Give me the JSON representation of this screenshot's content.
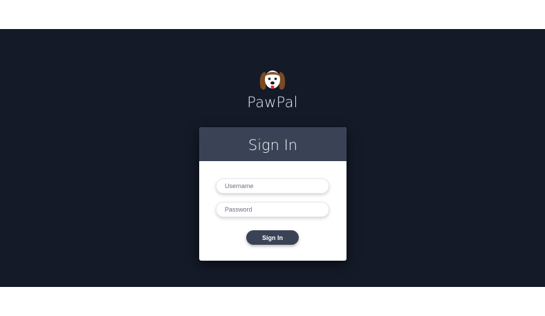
{
  "app": {
    "brand_name": "PawPal",
    "logo_icon": "dog-face-icon"
  },
  "signin_card": {
    "title": "Sign In",
    "username_placeholder": "Username",
    "username_value": "",
    "password_placeholder": "Password",
    "password_value": "",
    "submit_label": "Sign In"
  },
  "colors": {
    "background": "#141a28",
    "card_header": "#3a4356",
    "button": "#3a4356",
    "card_body": "#ffffff"
  }
}
